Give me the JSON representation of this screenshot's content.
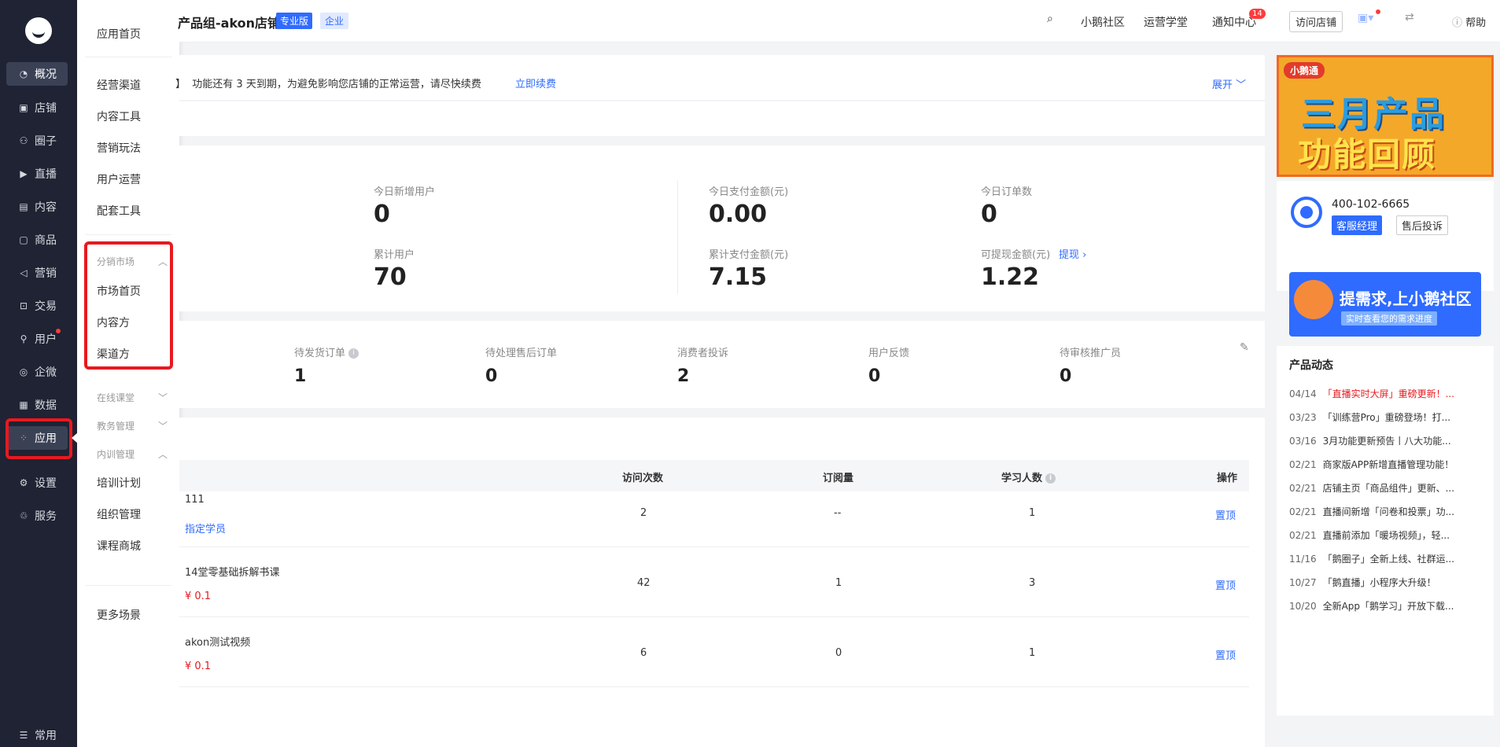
{
  "sidebar": {
    "items": [
      {
        "label": "概况",
        "icon": "pie-chart-icon"
      },
      {
        "label": "店铺",
        "icon": "store-icon"
      },
      {
        "label": "圈子",
        "icon": "circle-group-icon"
      },
      {
        "label": "直播",
        "icon": "live-icon"
      },
      {
        "label": "内容",
        "icon": "content-icon"
      },
      {
        "label": "商品",
        "icon": "goods-icon"
      },
      {
        "label": "营销",
        "icon": "megaphone-icon"
      },
      {
        "label": "交易",
        "icon": "transaction-icon"
      },
      {
        "label": "用户",
        "icon": "user-icon"
      },
      {
        "label": "企微",
        "icon": "wecom-icon"
      },
      {
        "label": "数据",
        "icon": "data-icon"
      },
      {
        "label": "应用",
        "icon": "apps-icon"
      },
      {
        "label": "设置",
        "icon": "gear-icon"
      },
      {
        "label": "服务",
        "icon": "service-icon"
      }
    ],
    "bottom_label": "常用"
  },
  "submenu": {
    "home": "应用首页",
    "items_top": [
      "经营渠道",
      "内容工具",
      "营销玩法",
      "用户运营",
      "配套工具"
    ],
    "group_distribution": "分销市场",
    "distribution_items": [
      "市场首页",
      "内容方",
      "渠道方"
    ],
    "group_online_class": "在线课堂",
    "group_edu": "教务管理",
    "group_training": "内训管理",
    "training_items": [
      "培训计划",
      "组织管理",
      "课程商城"
    ],
    "more": "更多场景"
  },
  "header": {
    "shop_name": "产品组-akon店铺",
    "badge_pro": "专业版",
    "badge_ent": "企业",
    "links": [
      "小鹅社区",
      "运营学堂",
      "通知中心"
    ],
    "notif_count": "14",
    "visit_button": "访问店铺",
    "help": "帮助"
  },
  "notice": {
    "bracket": "】",
    "text": "功能还有 3 天到期，为避免影响您店铺的正常运营，请尽快续费",
    "renew": "立即续费",
    "expand": "展开"
  },
  "stats": [
    {
      "label": "今日新增用户",
      "value": "0"
    },
    {
      "label": "今日支付金额(元)",
      "value": "0.00"
    },
    {
      "label": "今日订单数",
      "value": "0"
    },
    {
      "label": "累计用户",
      "value": "70"
    },
    {
      "label": "累计支付金额(元)",
      "value": "7.15"
    },
    {
      "label": "可提现金额(元)",
      "value": "1.22"
    }
  ],
  "withdraw_link": "提现",
  "todos": [
    {
      "label": "待发货订单",
      "value": "1"
    },
    {
      "label": "待处理售后订单",
      "value": "0"
    },
    {
      "label": "消费者投诉",
      "value": "2"
    },
    {
      "label": "用户反馈",
      "value": "0"
    },
    {
      "label": "待审核推广员",
      "value": "0"
    }
  ],
  "table": {
    "headers": [
      "访问次数",
      "订阅量",
      "学习人数",
      "操作"
    ],
    "rows": [
      {
        "name": "111",
        "sub": "指定学员",
        "visits": "2",
        "subs": "--",
        "learners": "1",
        "action": "置顶"
      },
      {
        "name": "14堂零基础拆解书课",
        "sub": "¥ 0.1",
        "visits": "42",
        "subs": "1",
        "learners": "3",
        "action": "置顶"
      },
      {
        "name": "akon测试视频",
        "sub": "¥ 0.1",
        "visits": "6",
        "subs": "0",
        "learners": "1",
        "action": "置顶"
      }
    ]
  },
  "right": {
    "banner_brand": "小鹅通",
    "banner_line1": "三月产品",
    "banner_line2": "功能回顾",
    "phone": "400-102-6665",
    "btn_manager": "客服经理",
    "btn_complain": "售后投诉",
    "promo_title": "提需求,上小鹅社区",
    "promo_sub": "实时查看您的需求进度",
    "news_title": "产品动态",
    "news": [
      {
        "date": "04/14",
        "text": "「直播实时大屏」重磅更新！..."
      },
      {
        "date": "03/23",
        "text": "「训练营Pro」重磅登场！打..."
      },
      {
        "date": "03/16",
        "text": "3月功能更新预告丨八大功能..."
      },
      {
        "date": "02/21",
        "text": "商家版APP新增直播管理功能！"
      },
      {
        "date": "02/21",
        "text": "店铺主页「商品组件」更新、..."
      },
      {
        "date": "02/21",
        "text": "直播间新增「问卷和投票」功..."
      },
      {
        "date": "02/21",
        "text": "直播前添加「暖场视频」，轻..."
      },
      {
        "date": "11/16",
        "text": "「鹅圈子」全新上线、社群运..."
      },
      {
        "date": "10/27",
        "text": "「鹅直播」小程序大升级！"
      },
      {
        "date": "10/20",
        "text": "全新App「鹅学习」开放下载..."
      }
    ]
  }
}
